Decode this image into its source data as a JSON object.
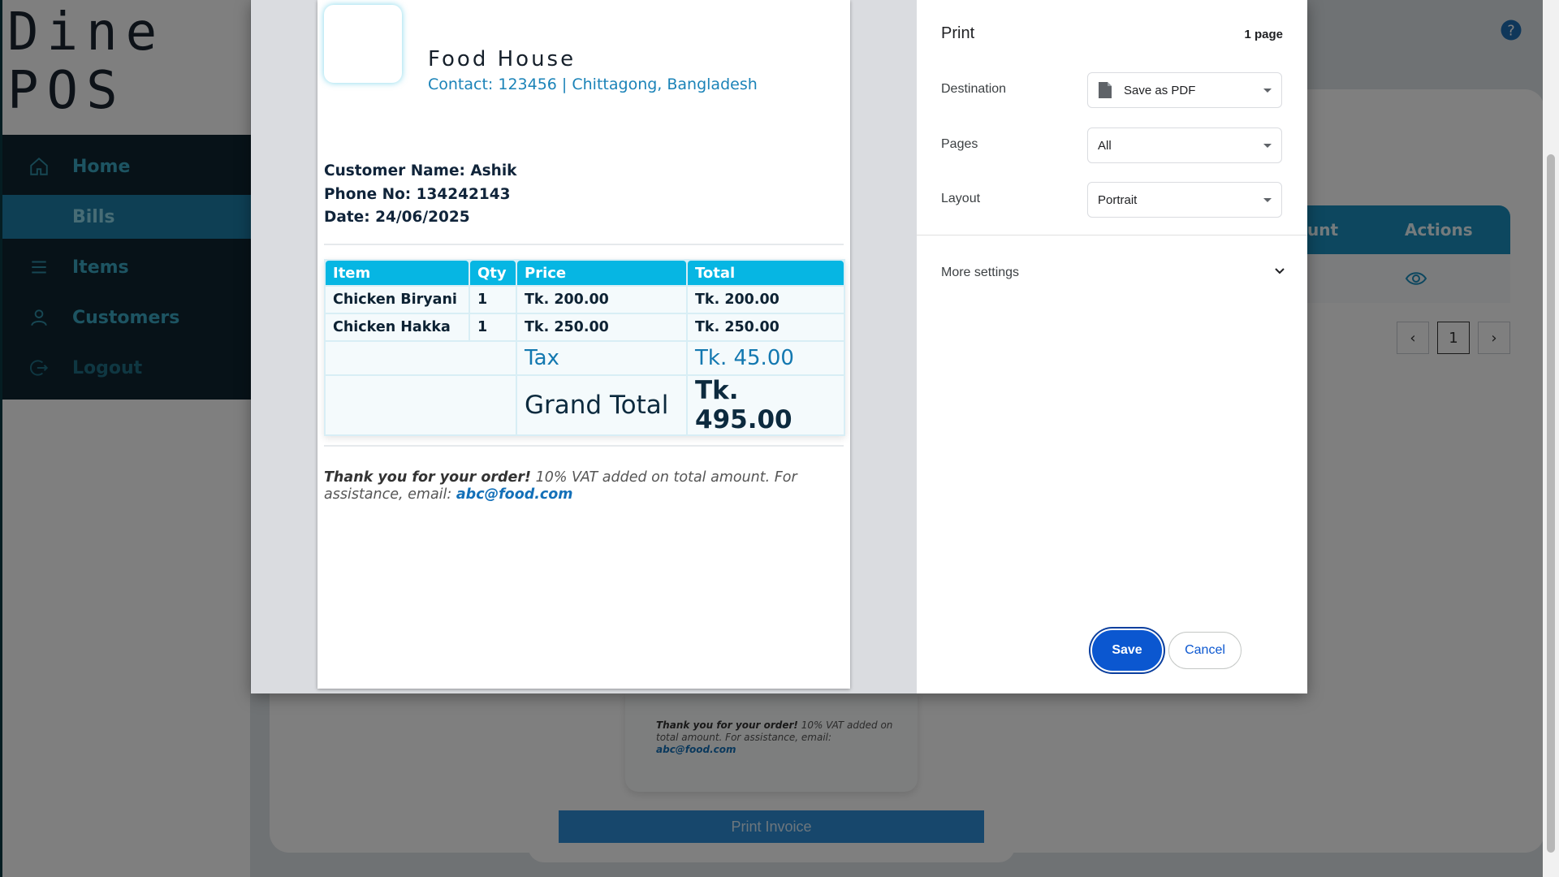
{
  "app": {
    "brand_line1": "Dine",
    "brand_line2": "POS",
    "nav": [
      {
        "label": "Home",
        "icon": "home-icon"
      },
      {
        "label": "Bills",
        "icon": "bills-icon"
      },
      {
        "label": "Items",
        "icon": "list-icon"
      },
      {
        "label": "Customers",
        "icon": "user-icon"
      },
      {
        "label": "Logout",
        "icon": "logout-icon"
      }
    ],
    "active_nav": "Bills",
    "table_headers": {
      "amount_partial": "unt",
      "actions": "Actions"
    },
    "pager": {
      "prev": "‹",
      "current": "1",
      "next": "›"
    },
    "invoice_modal": {
      "thanks_bold": "Thank you for your order!",
      "thanks_rest": " 10% VAT added on total amount. For assistance, email: ",
      "email": "abc@food.com",
      "print_button": "Print Invoice"
    }
  },
  "print_dialog": {
    "title": "Print",
    "page_count": "1 page",
    "destination": {
      "label": "Destination",
      "value": "Save as PDF"
    },
    "pages": {
      "label": "Pages",
      "value": "All"
    },
    "layout": {
      "label": "Layout",
      "value": "Portrait"
    },
    "more_settings": "More settings",
    "save_button": "Save",
    "cancel_button": "Cancel",
    "accent_color": "#0b57d0"
  },
  "invoice": {
    "shop_name": "Food House",
    "contact": "Contact: 123456 | Chittagong, Bangladesh",
    "customer_name": "Customer Name: Ashik",
    "phone": "Phone No: 134242143",
    "date": "Date: 24/06/2025",
    "columns": [
      "Item",
      "Qty",
      "Price",
      "Total"
    ],
    "rows": [
      {
        "item": "Chicken Biryani",
        "qty": "1",
        "price": "Tk. 200.00",
        "total": "Tk. 200.00"
      },
      {
        "item": "Chicken Hakka",
        "qty": "1",
        "price": "Tk. 250.00",
        "total": "Tk. 250.00"
      }
    ],
    "tax_label": "Tax",
    "tax_value": "Tk. 45.00",
    "grand_total_label": "Grand Total",
    "grand_total_value": "Tk. 495.00",
    "note_bold": "Thank you for your order!",
    "note_rest": " 10% VAT added on total amount. For assistance, email: ",
    "email": "abc@food.com",
    "header_color": "#06b6e3"
  }
}
